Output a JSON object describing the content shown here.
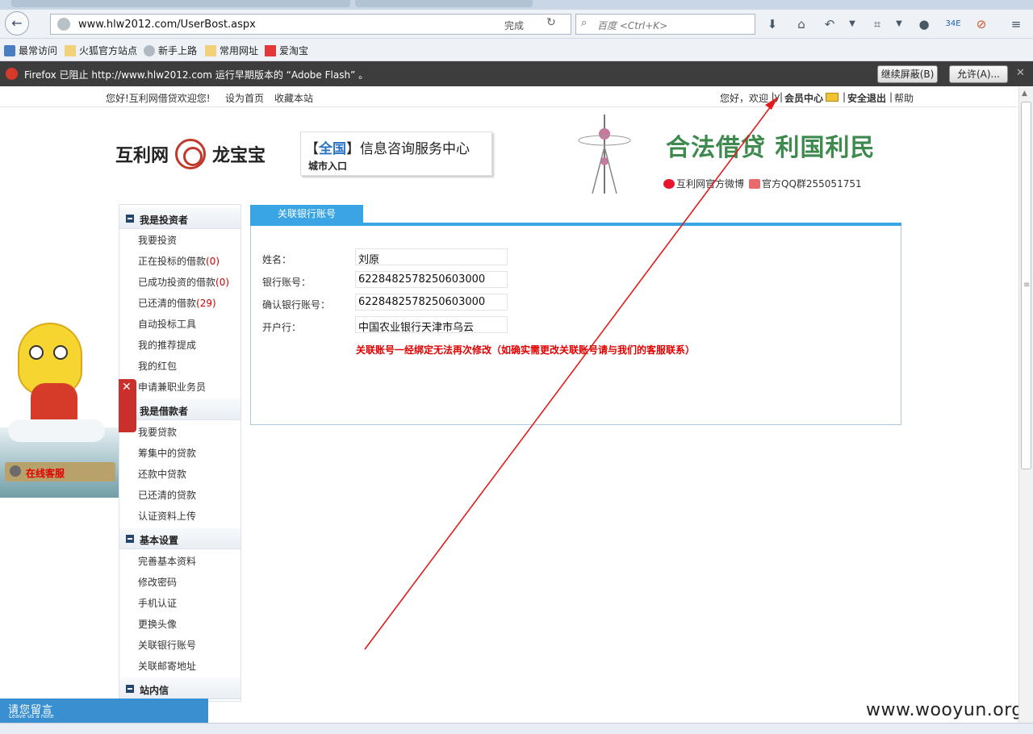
{
  "browser": {
    "url": "www.hlw2012.com/UserBost.aspx",
    "load_status": "完成",
    "search_placeholder": "百度 <Ctrl+K>",
    "bookmarks": [
      "最常访问",
      "火狐官方站点",
      "新手上路",
      "常用网址",
      "爱淘宝"
    ],
    "notification": {
      "message": "Firefox 已阻止 http://www.hlw2012.com 运行早期版本的 “Adobe Flash” 。",
      "block_button": "继续屏蔽(B)",
      "allow_button": "允许(A)..."
    }
  },
  "topbar": {
    "welcome": "您好!互利网借贷欢迎您!",
    "set_home": "设为首页",
    "bookmark_site": "收藏本站",
    "greeting": "您好，欢迎",
    "username": "ly",
    "sep": "|",
    "member_center": "会员中心",
    "logout": "安全退出",
    "help": "帮助"
  },
  "header": {
    "logo_left": "互利网",
    "logo_right": "龙宝宝",
    "city_bracket_open": "【",
    "city_scope": "全国",
    "city_bracket_close": "】",
    "city_title": "信息咨询服务中心",
    "city_entry": "城市入口",
    "slogan": "合法借贷  利国利民",
    "weibo": "互利网官方微博",
    "qq_group": "官方QQ群255051751"
  },
  "sidebar": {
    "sections": [
      {
        "title": "我是投资者",
        "items": [
          {
            "label": "我要投资",
            "count": ""
          },
          {
            "label": "正在投标的借款",
            "count": "(0)"
          },
          {
            "label": "已成功投资的借款",
            "count": "(0)"
          },
          {
            "label": "已还清的借款",
            "count": "(29)"
          },
          {
            "label": "自动投标工具",
            "count": ""
          },
          {
            "label": "我的推荐提成",
            "count": ""
          },
          {
            "label": "我的红包",
            "count": ""
          },
          {
            "label": "申请兼职业务员",
            "count": ""
          }
        ]
      },
      {
        "title": "我是借款者",
        "items": [
          {
            "label": "我要贷款",
            "count": ""
          },
          {
            "label": "筹集中的贷款",
            "count": ""
          },
          {
            "label": "还款中贷款",
            "count": ""
          },
          {
            "label": "已还清的贷款",
            "count": ""
          },
          {
            "label": "认证资料上传",
            "count": ""
          }
        ]
      },
      {
        "title": "基本设置",
        "items": [
          {
            "label": "完善基本资料",
            "count": ""
          },
          {
            "label": "修改密码",
            "count": ""
          },
          {
            "label": "手机认证",
            "count": ""
          },
          {
            "label": "更换头像",
            "count": ""
          },
          {
            "label": "关联银行账号",
            "count": ""
          },
          {
            "label": "关联邮寄地址",
            "count": ""
          }
        ]
      },
      {
        "title": "站内信",
        "items": []
      }
    ]
  },
  "main": {
    "tab": "关联银行账号",
    "fields": [
      {
        "label": "姓名：",
        "value": "刘原"
      },
      {
        "label": "银行账号：",
        "value": "6228482578250603000"
      },
      {
        "label": "确认银行账号：",
        "value": "6228482578250603000"
      },
      {
        "label": "开户行：",
        "value": "中国农业银行天津市乌云"
      }
    ],
    "notice": "关联账号一经绑定无法再次修改（如确实需更改关联账号请与我们的客服联系）"
  },
  "widgets": {
    "online_service": "在线客服",
    "leave_message": "请您留言",
    "leave_message_en": "Leave us a note",
    "close_x": "✕"
  },
  "watermark": "www.wooyun.org",
  "colors": {
    "accent_blue": "#3aa5e5",
    "alert_red": "#e00000",
    "slogan_green": "#3e8a4e",
    "annotation_arrow": "#e31b1b"
  }
}
